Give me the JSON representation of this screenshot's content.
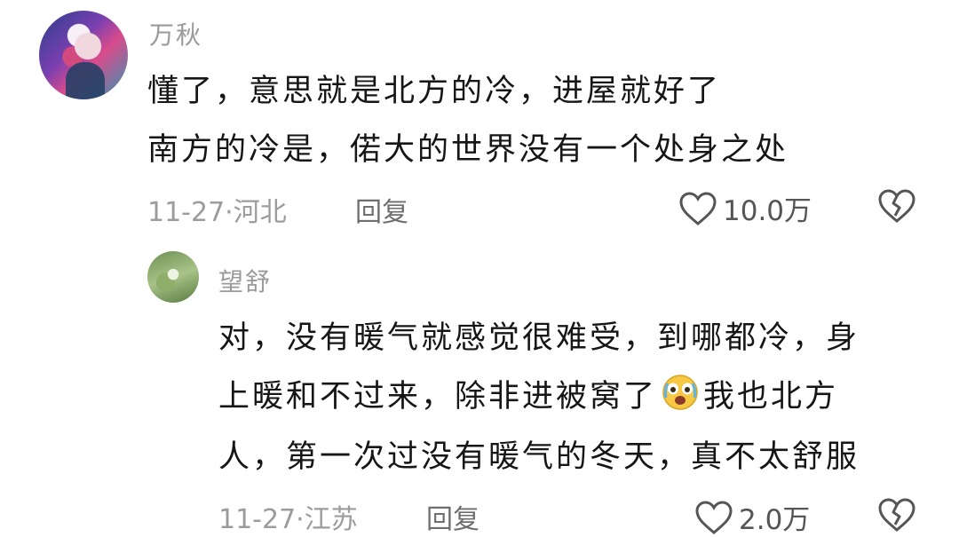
{
  "comment": {
    "username": "万秋",
    "text_line1": "懂了，意思就是北方的冷，进屋就好了",
    "text_line2": "南方的冷是，偌大的世界没有一个处身之处",
    "date_location": "11-27·河北",
    "reply_label": "回复",
    "like_count": "10.0万"
  },
  "reply": {
    "username": "望舒",
    "text_line1": "对，没有暖气就感觉很难受，到哪都冷，身",
    "text_line2a": "上暖和不过来，除非进被窝了",
    "text_line2b": "我也北方",
    "text_line3": "人，第一次过没有暖气的冬天，真不太舒服",
    "date_location": "11-27·江苏",
    "reply_label": "回复",
    "like_count": "2.0万"
  },
  "icons": {
    "like": "heart-outline-icon",
    "dislike": "broken-heart-icon",
    "emoji": "crying-laughing-emoji"
  }
}
